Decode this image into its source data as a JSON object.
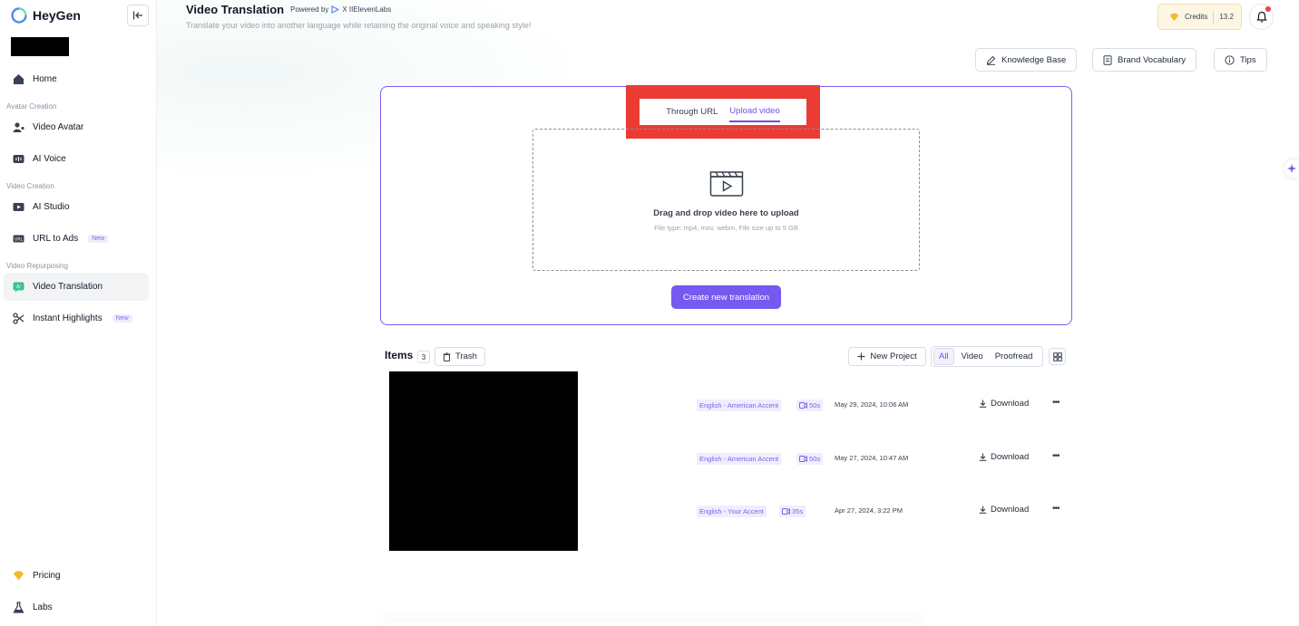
{
  "app": {
    "brand": "HeyGen"
  },
  "sidebar": {
    "items": [
      {
        "label": "Home",
        "icon": "home-icon"
      },
      {
        "label": "Video Avatar",
        "icon": "avatar-icon"
      },
      {
        "label": "AI Voice",
        "icon": "voice-icon"
      },
      {
        "label": "AI Studio",
        "icon": "studio-icon"
      },
      {
        "label": "URL to Ads",
        "icon": "url-icon",
        "badge": "New"
      },
      {
        "label": "Video Translation",
        "icon": "translate-icon",
        "active": true
      },
      {
        "label": "Instant Highlights",
        "icon": "scissors-icon",
        "badge": "New"
      },
      {
        "label": "Pricing",
        "icon": "diamond-icon"
      },
      {
        "label": "Labs",
        "icon": "flask-icon"
      }
    ],
    "sections": [
      "Avatar Creation",
      "Video Creation",
      "Video Repurposing"
    ]
  },
  "header": {
    "title": "Video Translation",
    "powered_by": "Powered by",
    "powered_partner": "X IIElevenLabs",
    "subtitle": "Translate your video into another language while retaining the original voice and speaking style!",
    "credits_label": "Credits",
    "credits_value": "13.2"
  },
  "toolbar": {
    "knowledge_base": "Knowledge Base",
    "brand_vocabulary": "Brand Vocabulary",
    "tips": "Tips"
  },
  "upload": {
    "tabs": [
      {
        "label": "Through URL"
      },
      {
        "label": "Upload video",
        "active": true
      }
    ],
    "drop_title": "Drag and drop video here to upload",
    "drop_sub": "File type: mp4, mov, webm, File size up to 5 GB",
    "create_button": "Create new translation"
  },
  "items": {
    "title": "Items",
    "count": "3",
    "trash": "Trash",
    "new_project": "New Project",
    "filters": [
      "All",
      "Video",
      "Proofread"
    ],
    "rows": [
      {
        "language": "English - American Accent",
        "duration": "50s",
        "date": "May 29, 2024, 10:06 AM",
        "download": "Download"
      },
      {
        "language": "English - American Accent",
        "duration": "50s",
        "date": "May 27, 2024, 10:47 AM",
        "download": "Download"
      },
      {
        "language": "English - Your Accent",
        "duration": "35s",
        "date": "Apr 27, 2024, 3:22 PM",
        "download": "Download"
      }
    ]
  },
  "colors": {
    "accent": "#7559f0",
    "highlight": "#ea3b35",
    "credits_bg": "#fdf6e3"
  }
}
